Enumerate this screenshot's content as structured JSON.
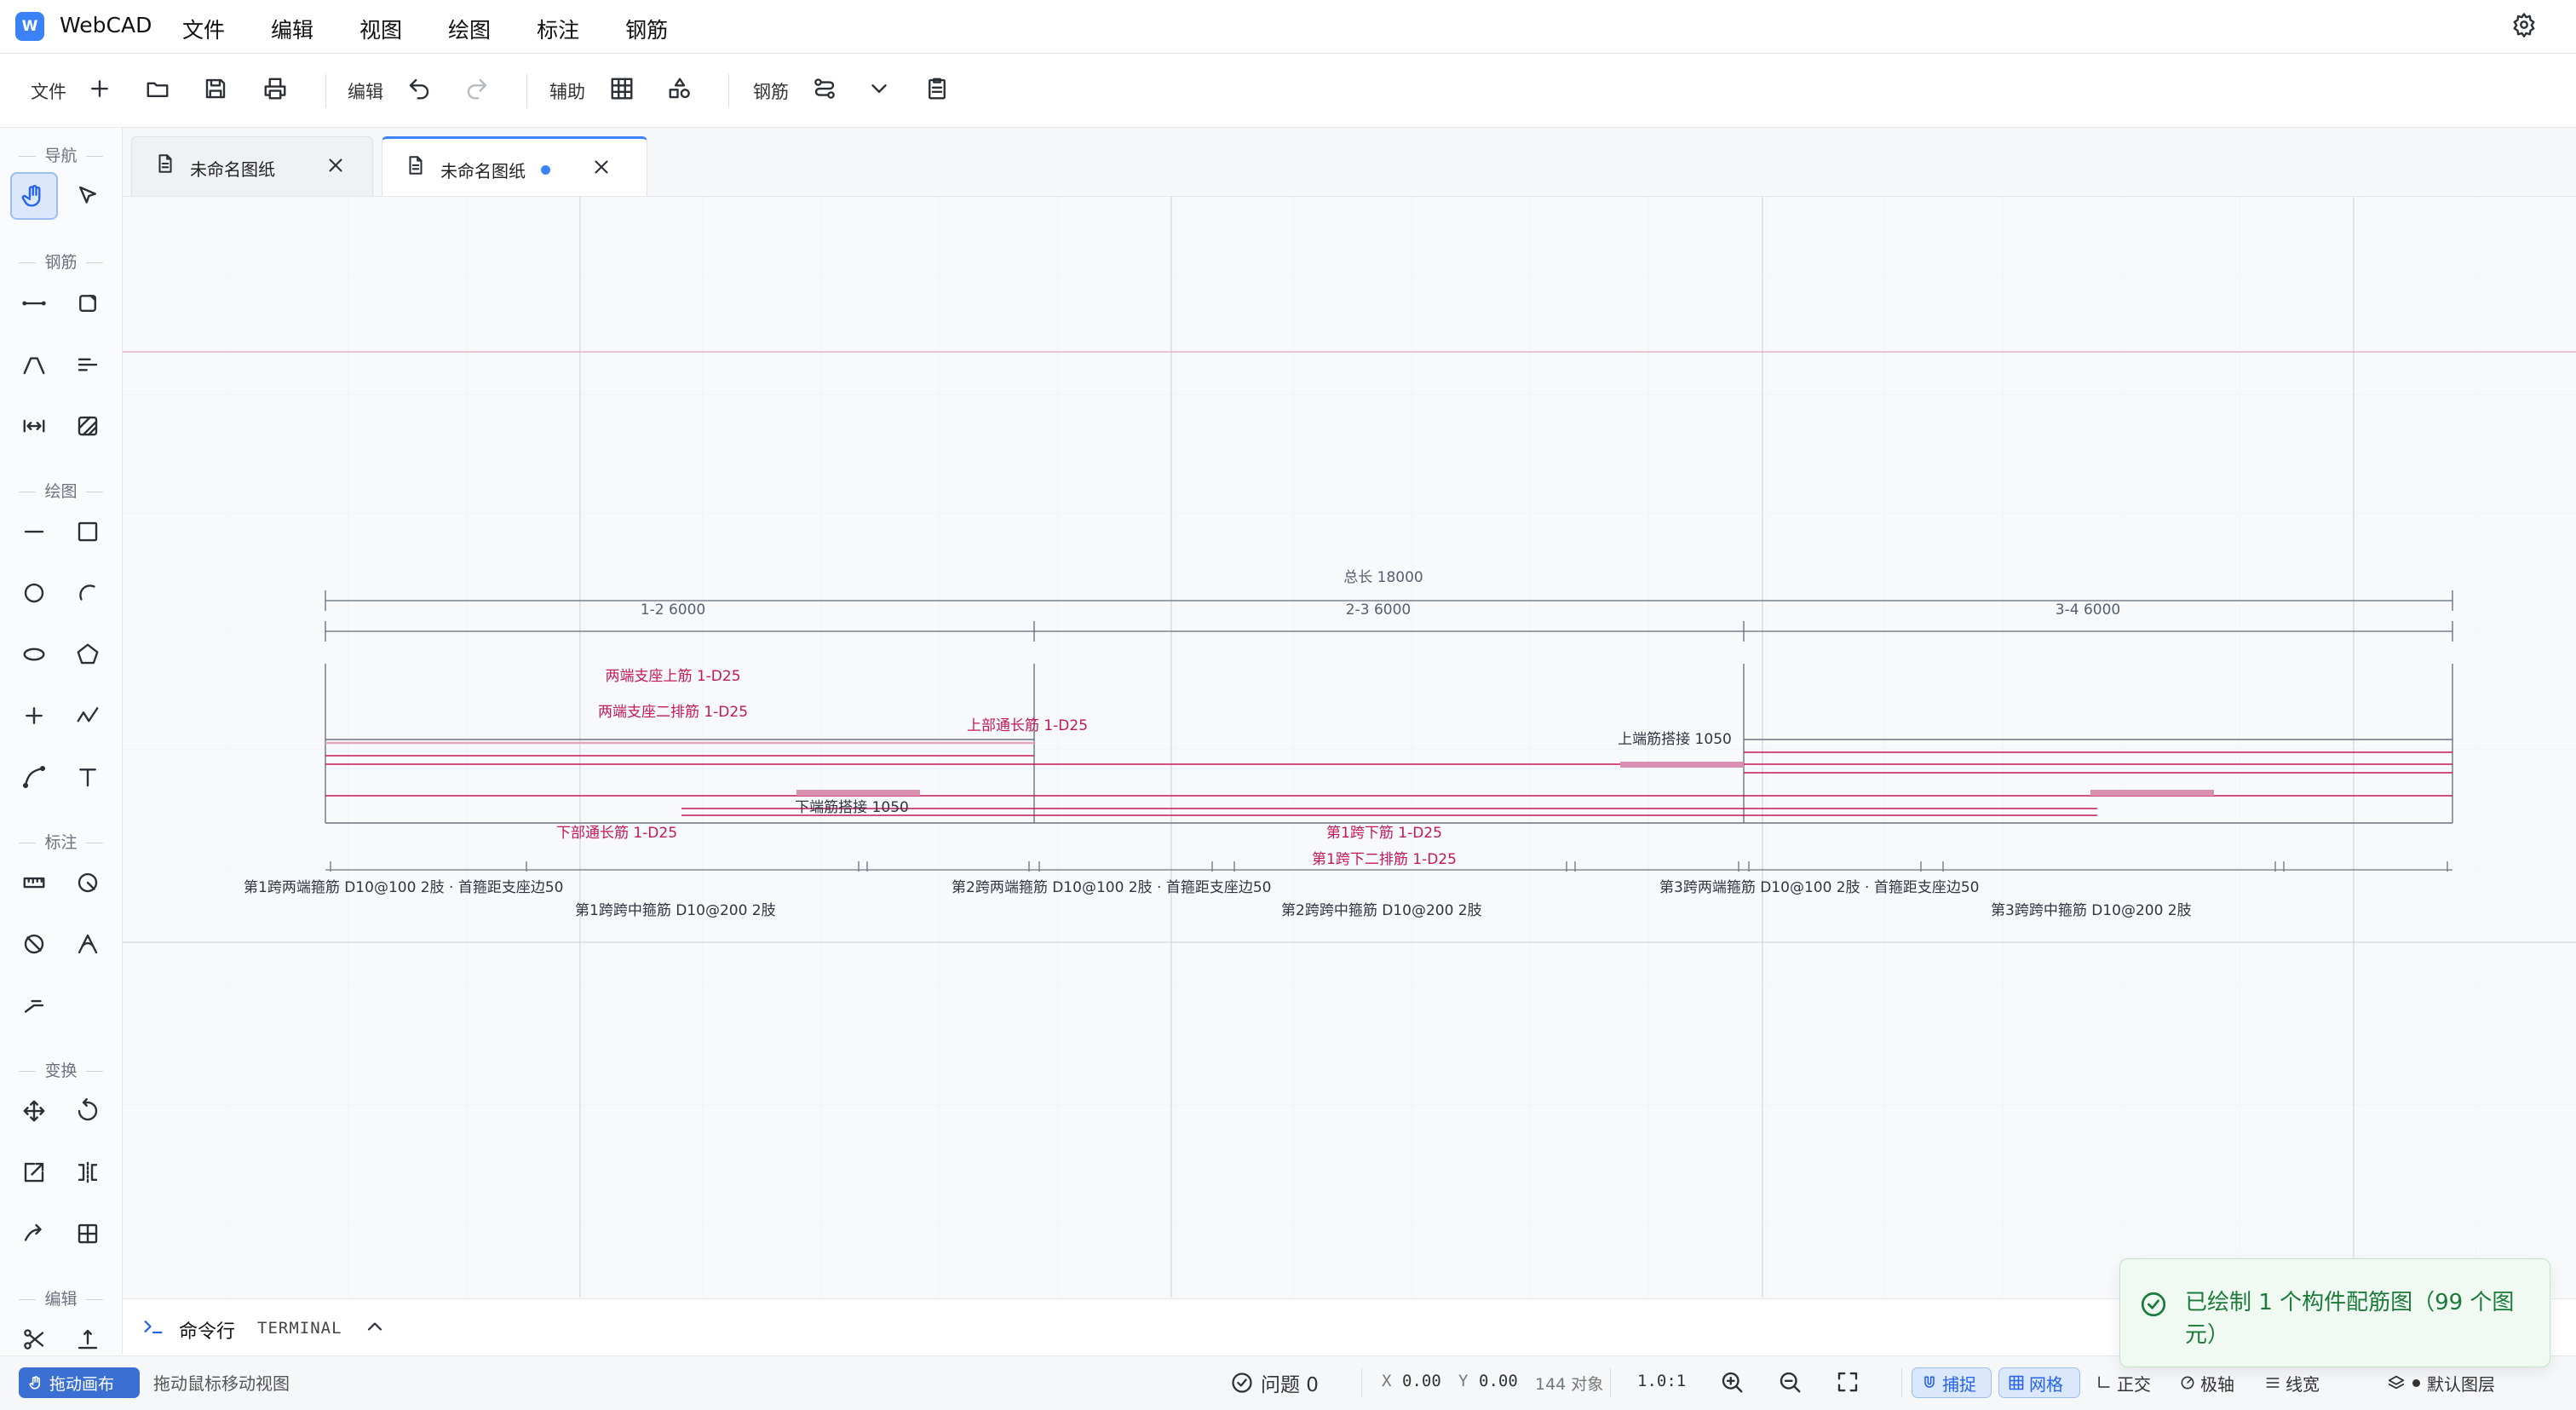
{
  "app": {
    "logo_text": "W",
    "title": "WebCAD"
  },
  "menu": [
    "文件",
    "编辑",
    "视图",
    "绘图",
    "标注",
    "钢筋"
  ],
  "toolbar": {
    "file_label": "文件",
    "edit_label": "编辑",
    "aux_label": "辅助",
    "rebar_label": "钢筋"
  },
  "tool_panel": {
    "navigate": "导航",
    "rebar": "钢筋",
    "draw": "绘图",
    "annotate": "标注",
    "transform": "变换",
    "edit": "编辑"
  },
  "tabs": [
    {
      "label": "未命名图纸",
      "active": false,
      "modified": false
    },
    {
      "label": "未命名图纸",
      "active": true,
      "modified": true
    }
  ],
  "drawing": {
    "total": "总长 18000",
    "spans": [
      "1-2 6000",
      "2-3 6000",
      "3-4 6000"
    ],
    "labels": {
      "top_support": "两端支座上筋 1-D25",
      "top_support_2": "两端支座二排筋 1-D25",
      "top_through": "上部通长筋 1-D25",
      "top_lap": "上端筋搭接 1050",
      "bottom_lap": "下端筋搭接 1050",
      "bottom_through": "下部通长筋 1-D25",
      "span1_bottom": "第1跨下筋 1-D25",
      "span1_bottom_2": "第1跨下二排筋 1-D25"
    },
    "stirrups": {
      "s1_end": "第1跨两端箍筋 D10@100 2肢 · 首箍距支座边50",
      "s1_mid": "第1跨跨中箍筋 D10@200 2肢",
      "s2_end": "第2跨两端箍筋 D10@100 2肢 · 首箍距支座边50",
      "s2_mid": "第2跨跨中箍筋 D10@200 2肢",
      "s3_end": "第3跨两端箍筋 D10@100 2肢 · 首箍距支座边50",
      "s3_mid": "第3跨跨中箍筋 D10@200 2肢"
    }
  },
  "terminal": {
    "label": "命令行",
    "tag": "TERMINAL"
  },
  "status": {
    "mode_button": "拖动画布",
    "hint": "拖动鼠标移动视图",
    "issues": "问题 0",
    "x_label": "X",
    "x_value": "0.00",
    "y_label": "Y",
    "y_value": "0.00",
    "objects": "144 对象",
    "scale": "1.0:1",
    "snap": "捕捉",
    "grid": "网格",
    "ortho": "正交",
    "polar": "极轴",
    "lineweight": "线宽",
    "layer": "默认图层"
  },
  "toast": {
    "message": "已绘制 1 个构件配筋图（99 个图元）"
  },
  "colors": {
    "accent": "#3b82f6",
    "rebar": "#c2185b",
    "success": "#1b7a3a"
  }
}
